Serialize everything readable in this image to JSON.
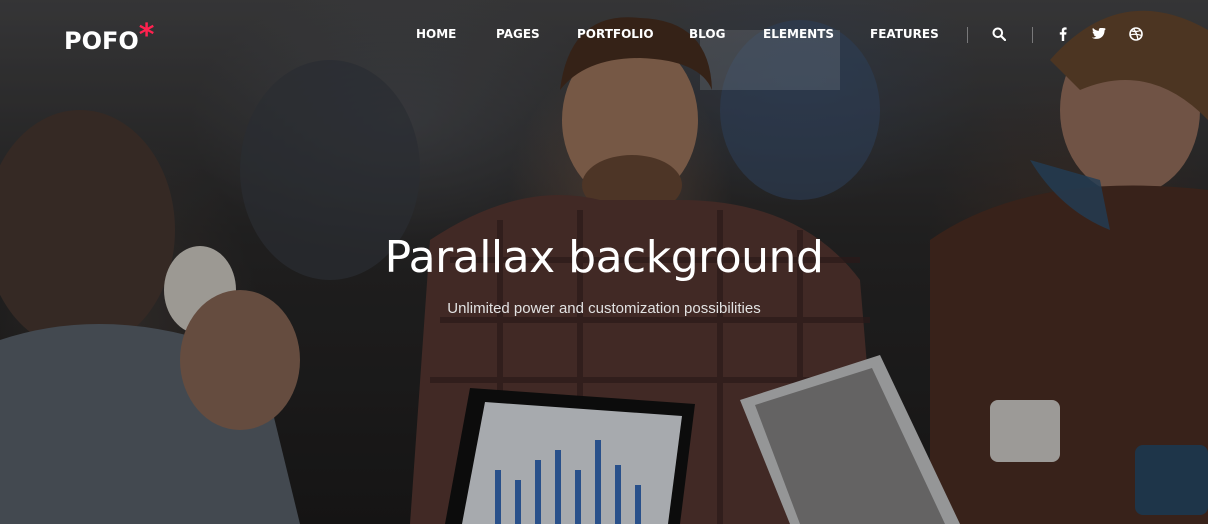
{
  "nav": {
    "logo_text": "POFO",
    "logo_mark": "*",
    "menu": [
      {
        "label": "HOME"
      },
      {
        "label": "PAGES"
      },
      {
        "label": "PORTFOLIO"
      },
      {
        "label": "BLOG"
      },
      {
        "label": "ELEMENTS"
      },
      {
        "label": "FEATURES"
      }
    ],
    "icons": [
      "search-icon",
      "facebook-icon",
      "twitter-icon",
      "dribbble-icon"
    ]
  },
  "hero": {
    "title": "Parallax background",
    "subtitle": "Unlimited power and customization possibilities"
  },
  "colors": {
    "accent": "#ff214f",
    "text": "#ffffff"
  }
}
